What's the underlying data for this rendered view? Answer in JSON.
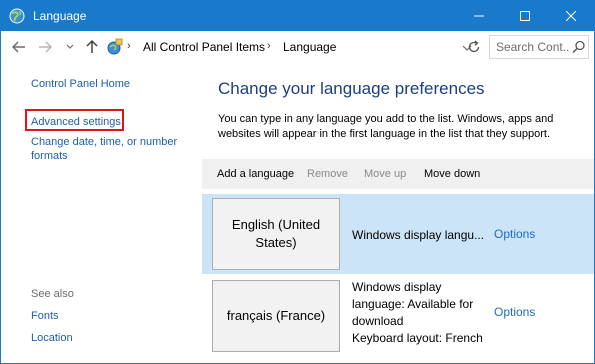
{
  "window": {
    "title": "Language",
    "accent_color": "#1979ca"
  },
  "address": {
    "crumbs": [
      "All Control Panel Items",
      "Language"
    ],
    "separator": "›",
    "search_placeholder": "Search Cont..."
  },
  "left": {
    "home": "Control Panel Home",
    "advanced": "Advanced settings",
    "date_time": "Change date, time, or number formats",
    "see_also": "See also",
    "fonts": "Fonts",
    "location": "Location",
    "highlight_color": "#e0151c"
  },
  "main": {
    "heading": "Change your language preferences",
    "description": "You can type in any language you add to the list. Windows, apps and websites will appear in the first language in the list that they support.",
    "toolbar": {
      "add": "Add a language",
      "remove": "Remove",
      "move_up": "Move up",
      "move_down": "Move down"
    },
    "languages": [
      {
        "name": "English (United States)",
        "info": [
          "Windows display langu..."
        ],
        "options": "Options",
        "selected": true
      },
      {
        "name": "français (France)",
        "info": [
          "Windows display",
          "language: Available for",
          "download",
          "Keyboard layout: French"
        ],
        "options": "Options",
        "selected": false
      }
    ]
  }
}
